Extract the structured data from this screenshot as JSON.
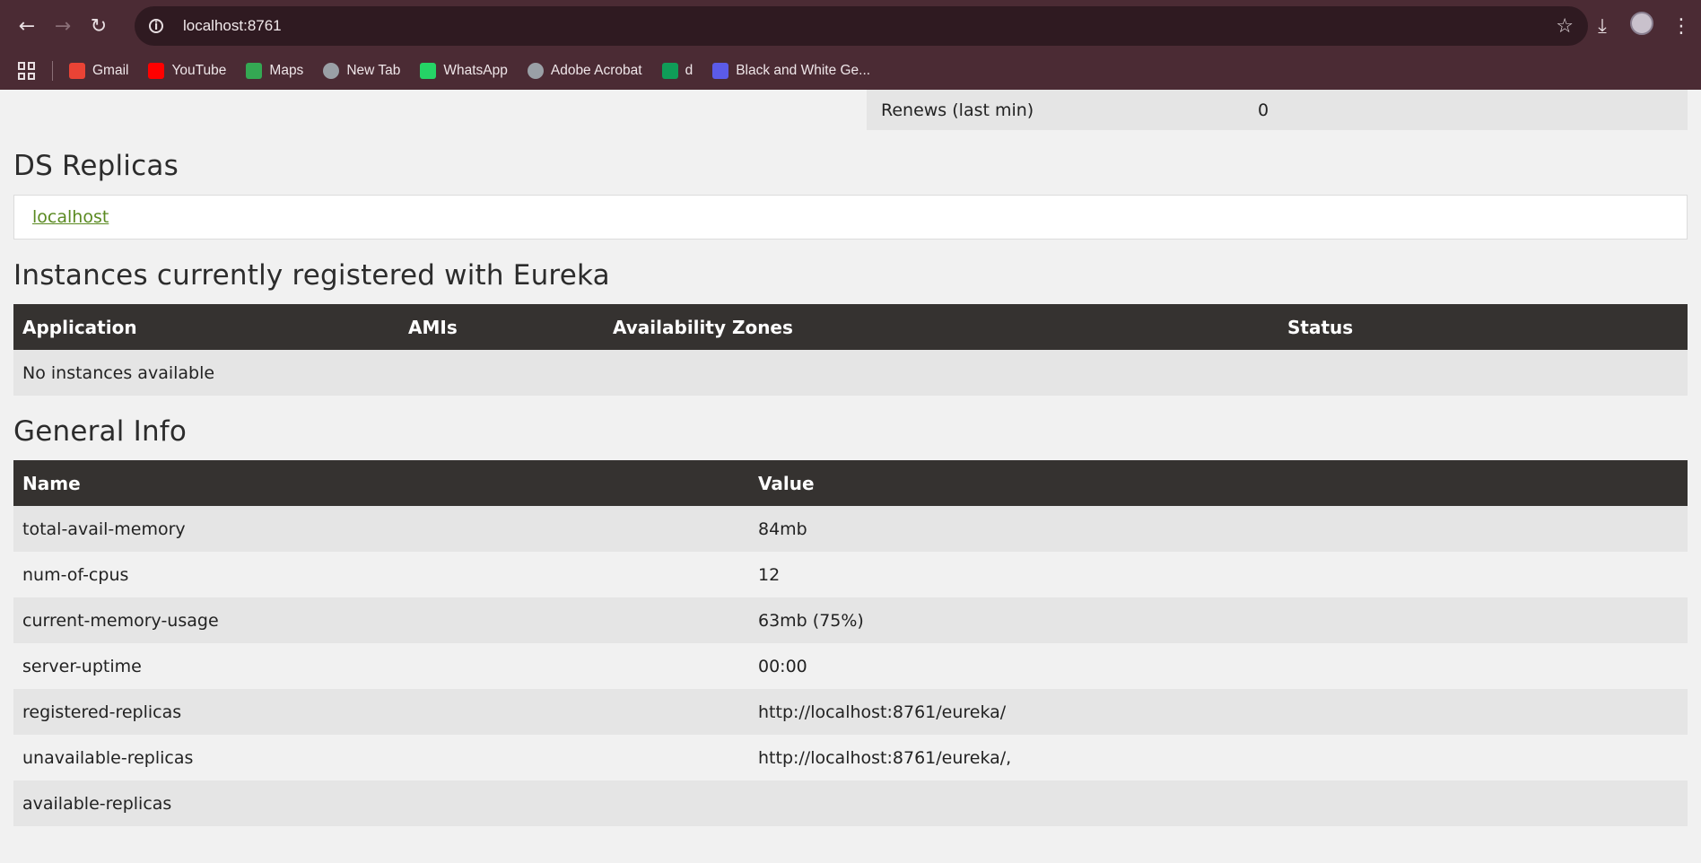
{
  "browser": {
    "url": "localhost:8761",
    "bookmarks": [
      {
        "label": "Gmail",
        "icon": "gmail-icon",
        "color": "#ea4335"
      },
      {
        "label": "YouTube",
        "icon": "youtube-icon",
        "color": "#ff0000"
      },
      {
        "label": "Maps",
        "icon": "maps-icon",
        "color": "#34a853"
      },
      {
        "label": "New Tab",
        "icon": "globe-icon",
        "color": "#9aa0a6"
      },
      {
        "label": "WhatsApp",
        "icon": "whatsapp-icon",
        "color": "#25d366"
      },
      {
        "label": "Adobe Acrobat",
        "icon": "globe-icon",
        "color": "#9aa0a6"
      },
      {
        "label": "d",
        "icon": "sheet-icon",
        "color": "#0f9d58"
      },
      {
        "label": "Black and White Ge...",
        "icon": "app-icon",
        "color": "#5b5be8"
      }
    ]
  },
  "renews": {
    "label": "Renews (last min)",
    "value": "0"
  },
  "ds_replicas": {
    "title": "DS Replicas",
    "link": "localhost"
  },
  "instances": {
    "title": "Instances currently registered with Eureka",
    "columns": [
      "Application",
      "AMIs",
      "Availability Zones",
      "Status"
    ],
    "empty_text": "No instances available"
  },
  "general_info": {
    "title": "General Info",
    "columns": [
      "Name",
      "Value"
    ],
    "rows": [
      {
        "name": "total-avail-memory",
        "value": "84mb"
      },
      {
        "name": "num-of-cpus",
        "value": "12"
      },
      {
        "name": "current-memory-usage",
        "value": "63mb (75%)"
      },
      {
        "name": "server-uptime",
        "value": "00:00"
      },
      {
        "name": "registered-replicas",
        "value": "http://localhost:8761/eureka/"
      },
      {
        "name": "unavailable-replicas",
        "value": "http://localhost:8761/eureka/,"
      },
      {
        "name": "available-replicas",
        "value": ""
      }
    ]
  }
}
